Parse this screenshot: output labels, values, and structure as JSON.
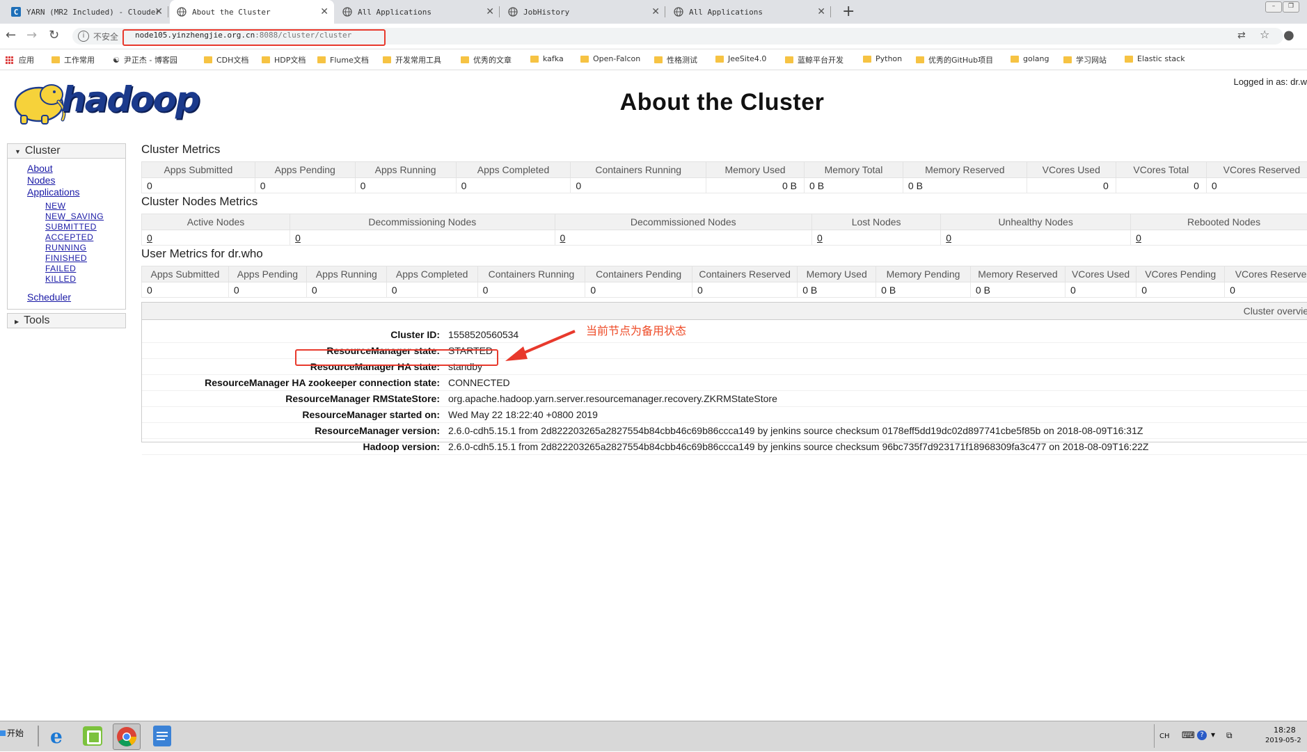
{
  "browser": {
    "tabs": [
      {
        "label": "YARN (MR2 Included) - Clouder",
        "active": false
      },
      {
        "label": "About the Cluster",
        "active": true
      },
      {
        "label": "All Applications",
        "active": false
      },
      {
        "label": "JobHistory",
        "active": false
      },
      {
        "label": "All Applications",
        "active": false
      }
    ],
    "new_tab": "+",
    "insecure_label": "不安全",
    "url_host": "node105.yinzhengjie.org.cn",
    "url_path": ":8088/cluster/cluster",
    "bookmarks": [
      "应用",
      "工作常用",
      "尹正杰 - 博客园",
      "CDH文档",
      "HDP文档",
      "Flume文档",
      "开发常用工具",
      "优秀的文章",
      "kafka",
      "Open-Falcon",
      "性格测试",
      "JeeSite4.0",
      "蓝鲸平台开发",
      "Python",
      "优秀的GitHub项目",
      "golang",
      "学习网站",
      "Elastic stack"
    ]
  },
  "page": {
    "logged_in": "Logged in as: dr.w",
    "logo_text": "hadoop",
    "title": "About the Cluster"
  },
  "sidebar": {
    "cluster_label": "Cluster",
    "links": [
      "About",
      "Nodes",
      "Applications"
    ],
    "app_states": [
      "NEW",
      "NEW_SAVING",
      "SUBMITTED",
      "ACCEPTED",
      "RUNNING",
      "FINISHED",
      "FAILED",
      "KILLED"
    ],
    "scheduler": "Scheduler",
    "tools_label": "Tools"
  },
  "cluster_metrics": {
    "title": "Cluster Metrics",
    "headers": [
      "Apps Submitted",
      "Apps Pending",
      "Apps Running",
      "Apps Completed",
      "Containers Running",
      "Memory Used",
      "Memory Total",
      "Memory Reserved",
      "VCores Used",
      "VCores Total",
      "VCores Reserved"
    ],
    "values": [
      "0",
      "0",
      "0",
      "0",
      "0",
      "0 B",
      "0 B",
      "0 B",
      "0",
      "0",
      "0"
    ]
  },
  "node_metrics": {
    "title": "Cluster Nodes Metrics",
    "headers": [
      "Active Nodes",
      "Decommissioning Nodes",
      "Decommissioned Nodes",
      "Lost Nodes",
      "Unhealthy Nodes",
      "Rebooted Nodes"
    ],
    "values": [
      "0",
      "0",
      "0",
      "0",
      "0",
      "0"
    ]
  },
  "user_metrics": {
    "title": "User Metrics for dr.who",
    "headers": [
      "Apps Submitted",
      "Apps Pending",
      "Apps Running",
      "Apps Completed",
      "Containers Running",
      "Containers Pending",
      "Containers Reserved",
      "Memory Used",
      "Memory Pending",
      "Memory Reserved",
      "VCores Used",
      "VCores Pending",
      "VCores Reserve"
    ],
    "values": [
      "0",
      "0",
      "0",
      "0",
      "0",
      "0",
      "0",
      "0 B",
      "0 B",
      "0 B",
      "0",
      "0",
      "0"
    ]
  },
  "overview": {
    "header": "Cluster overvie",
    "rows": [
      {
        "key": "Cluster ID:",
        "value": "1558520560534"
      },
      {
        "key": "ResourceManager state:",
        "value": "STARTED"
      },
      {
        "key": "ResourceManager HA state:",
        "value": "standby"
      },
      {
        "key": "ResourceManager HA zookeeper connection state:",
        "value": "CONNECTED"
      },
      {
        "key": "ResourceManager RMStateStore:",
        "value": "org.apache.hadoop.yarn.server.resourcemanager.recovery.ZKRMStateStore"
      },
      {
        "key": "ResourceManager started on:",
        "value": "Wed May 22 18:22:40 +0800 2019"
      },
      {
        "key": "ResourceManager version:",
        "value": "2.6.0-cdh5.15.1 from 2d822203265a2827554b84cbb46c69b86ccca149 by jenkins source checksum 0178eff5dd19dc02d897741cbe5f85b on 2018-08-09T16:31Z"
      },
      {
        "key": "Hadoop version:",
        "value": "2.6.0-cdh5.15.1 from 2d822203265a2827554b84cbb46c69b86ccca149 by jenkins source checksum 96bc735f7d923171f18968309fa3c477 on 2018-08-09T16:22Z"
      }
    ]
  },
  "annotation": "当前节点为备用状态",
  "taskbar": {
    "start": "开始",
    "lang": "CH",
    "time": "18:28",
    "date": "2019-05-2"
  },
  "colors": {
    "annotation_red": "#e8392c",
    "link_blue": "#1a1aa6",
    "logo_yellow": "#f6d23a",
    "logo_blue": "#1b3a8c"
  }
}
